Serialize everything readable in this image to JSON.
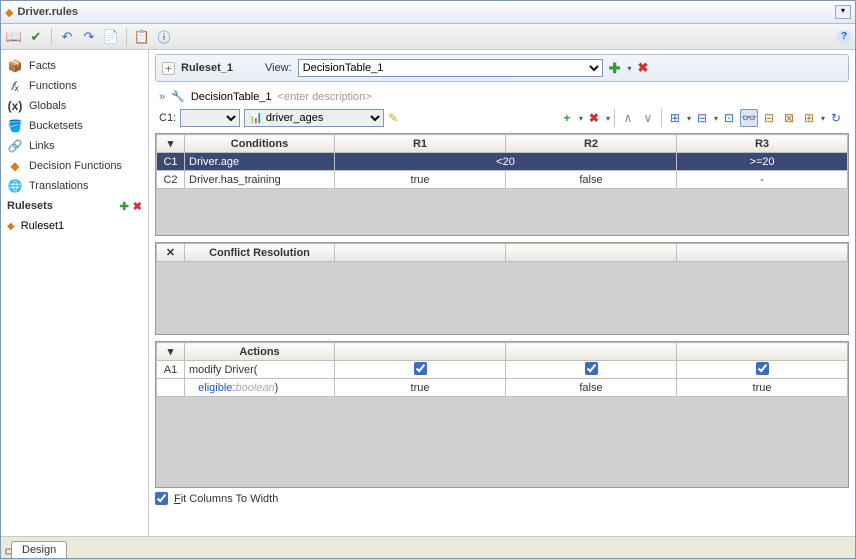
{
  "window": {
    "title": "Driver.rules"
  },
  "topToolbar": {
    "dictionary": "📖",
    "check": "✔",
    "undo": "↶",
    "redo": "↷",
    "import": "📄",
    "validate": "📋",
    "info": "ⓘ",
    "help": "?"
  },
  "nav": {
    "items": [
      {
        "icon": "📦",
        "label": "Facts"
      },
      {
        "icon": "𝑓ₓ",
        "label": "Functions"
      },
      {
        "icon": "(x)",
        "label": "Globals"
      },
      {
        "icon": "🪣",
        "label": "Bucketsets"
      },
      {
        "icon": "🔗",
        "label": "Links"
      },
      {
        "icon": "◆",
        "label": "Decision Functions"
      },
      {
        "icon": "🌐",
        "label": "Translations"
      }
    ],
    "rulesetsLabel": "Rulesets",
    "ruleset1": "Ruleset1"
  },
  "rulesetBar": {
    "exp": "+",
    "name": "Ruleset_1",
    "viewLabel": "View:",
    "viewOption": "DecisionTable_1"
  },
  "dtHeader": {
    "chevrons": "»",
    "wrench": "🔧",
    "name": "DecisionTable_1",
    "descPlaceholder": "<enter description>"
  },
  "filter": {
    "c1": "C1:",
    "condSelect": "",
    "bucketSelect": "driver_ages",
    "pencil": "✎"
  },
  "dtToolbar": {
    "add": "+",
    "del": "✖",
    "up": "∧",
    "down": "∨",
    "gap": "⊞",
    "overlap": "⊟",
    "split": "⊡",
    "glasses": "👓",
    "merge": "⊟",
    "conflict": "⊠",
    "more": "⊞",
    "refresh": "↻"
  },
  "table": {
    "conditionsHdr": "Conditions",
    "cols": [
      "R1",
      "R2",
      "R3"
    ],
    "conditions": [
      {
        "id": "C1",
        "name": "Driver.age",
        "vals": [
          "<20",
          "<20",
          ">=20"
        ],
        "merged01": true
      },
      {
        "id": "C2",
        "name": "Driver.has_training",
        "vals": [
          "true",
          "false",
          "-"
        ]
      }
    ],
    "conflictHdr": "Conflict Resolution",
    "conflictX": "✕",
    "actionsHdr": "Actions",
    "actions": [
      {
        "id": "A1",
        "name": "modify Driver(",
        "checks": [
          true,
          true,
          true
        ]
      }
    ],
    "eligible": {
      "label": "eligible:",
      "type": "boolean",
      "close": ")",
      "vals": [
        "true",
        "false",
        "true"
      ]
    }
  },
  "fitLabel": "Fit Columns To Width",
  "fitChecked": true,
  "bottomTab": "Design",
  "gutter": "⊏"
}
